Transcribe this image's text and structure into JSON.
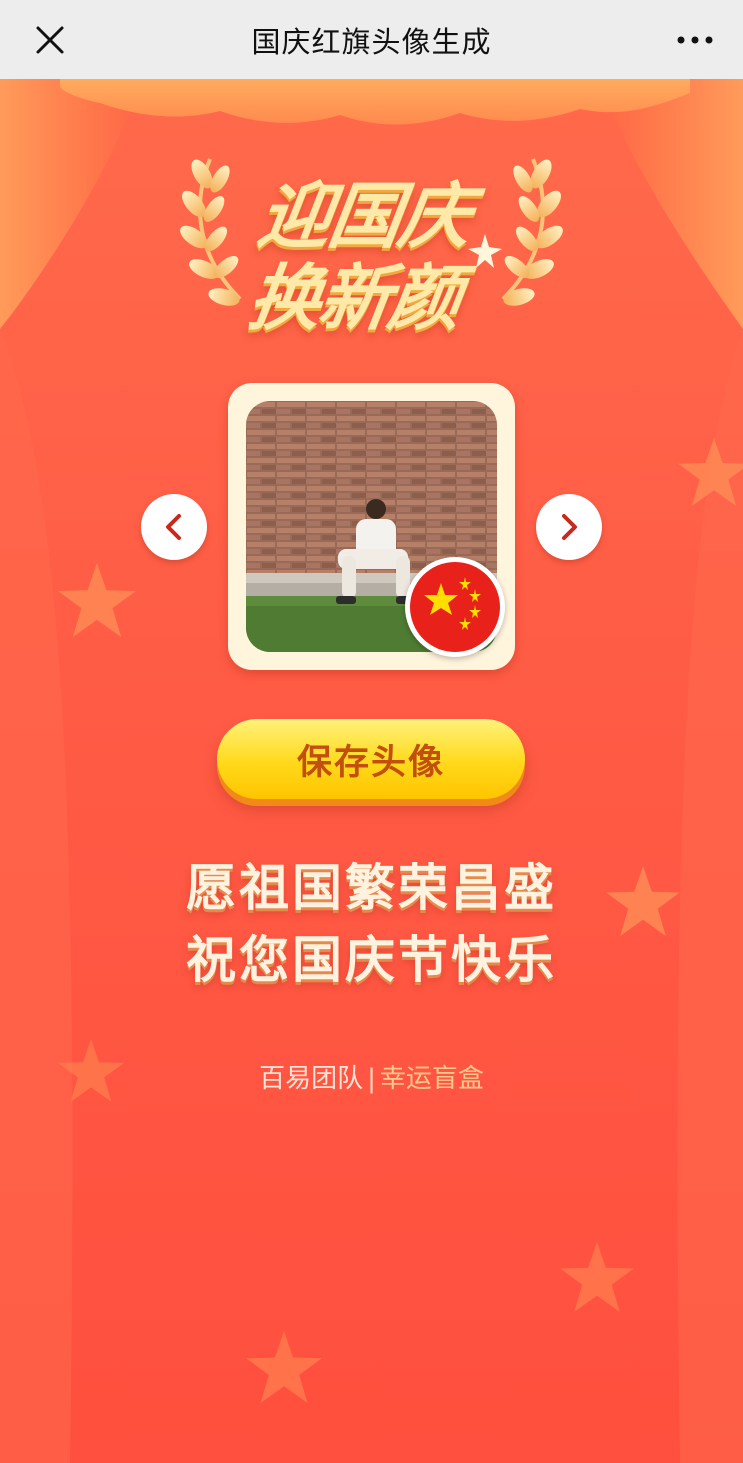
{
  "window": {
    "title": "国庆红旗头像生成",
    "close_icon": "close-icon",
    "more_icon": "more-dots-icon"
  },
  "headline": {
    "line1": "迎国庆",
    "line2": "换新颜"
  },
  "avatar": {
    "prev_icon": "chevron-left-icon",
    "next_icon": "chevron-right-icon",
    "badge_icon": "china-flag-icon"
  },
  "save_button": {
    "label": "保存头像"
  },
  "blessing": {
    "line1": "愿祖国繁荣昌盛",
    "line2": "祝您国庆节快乐"
  },
  "credits": {
    "team": "百易团队",
    "separator": "|",
    "link": "幸运盲盒"
  },
  "colors": {
    "background": "#ff5a45",
    "button_yellow": "#ffd91a",
    "button_text": "#c24f0e",
    "accent_gold": "#ffe9a8"
  }
}
